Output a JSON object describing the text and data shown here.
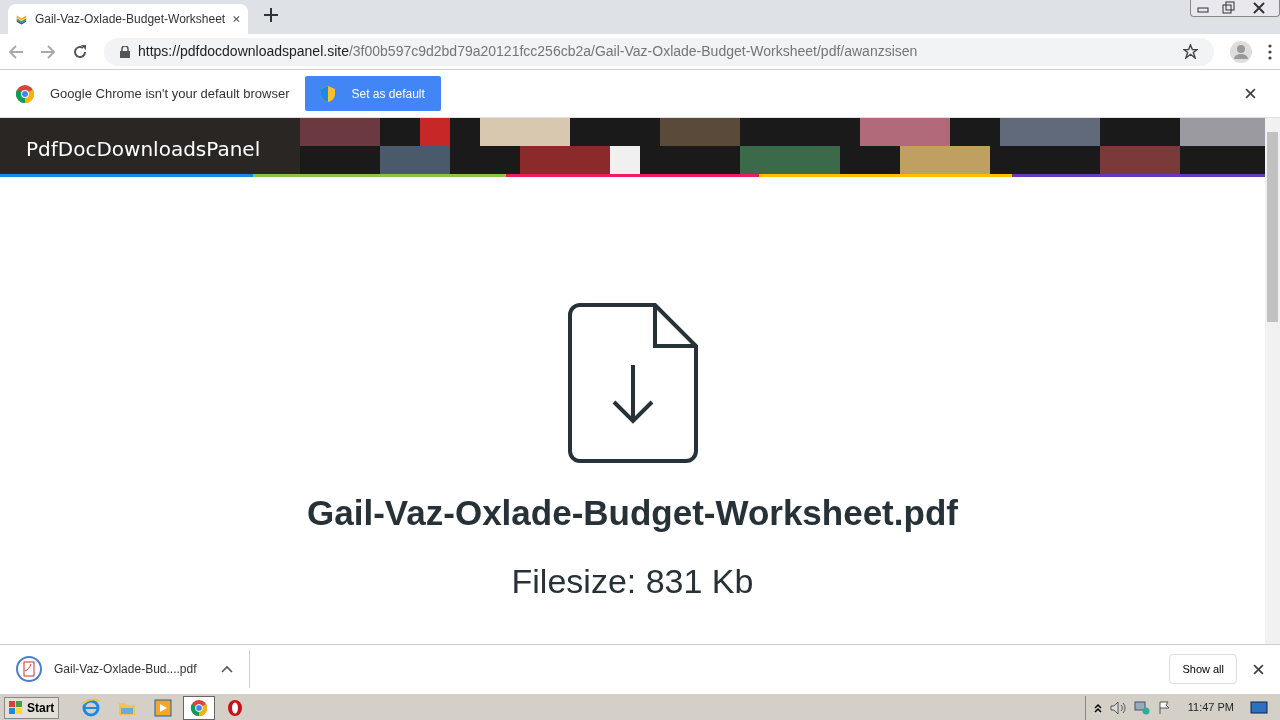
{
  "browser": {
    "tab": {
      "title": "Gail-Vaz-Oxlade-Budget-Worksheet"
    },
    "address": {
      "host": "https://pdfdocdownloadspanel.site",
      "path": "/3f00b597c9d2bd79a20121fcc256cb2a/Gail-Vaz-Oxlade-Budget-Worksheet/pdf/awanzsisen"
    },
    "infobar": {
      "message": "Google Chrome isn't your default browser",
      "button": "Set as default"
    }
  },
  "site": {
    "brand": "PdfDocDownloadsPanel",
    "file_name": "Gail-Vaz-Oxlade-Budget-Worksheet.pdf",
    "file_size": "Filesize: 831 Kb"
  },
  "download_bar": {
    "items": [
      {
        "name": "Gail-Vaz-Oxlade-Bud....pdf"
      }
    ],
    "show_all": "Show all"
  },
  "taskbar": {
    "start": "Start",
    "apps": [
      {
        "kind": "ie",
        "selected": false
      },
      {
        "kind": "folder",
        "selected": false
      },
      {
        "kind": "media",
        "selected": false
      },
      {
        "kind": "chrome",
        "selected": true
      },
      {
        "kind": "opera",
        "selected": false
      }
    ],
    "clock": "11:47 PM"
  }
}
